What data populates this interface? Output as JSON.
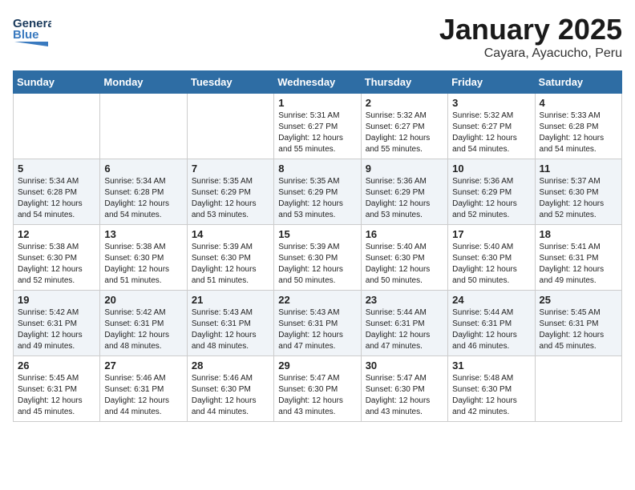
{
  "logo": {
    "line1": "General",
    "line2": "Blue"
  },
  "header": {
    "month": "January 2025",
    "location": "Cayara, Ayacucho, Peru"
  },
  "weekdays": [
    "Sunday",
    "Monday",
    "Tuesday",
    "Wednesday",
    "Thursday",
    "Friday",
    "Saturday"
  ],
  "weeks": [
    [
      {
        "day": "",
        "info": ""
      },
      {
        "day": "",
        "info": ""
      },
      {
        "day": "",
        "info": ""
      },
      {
        "day": "1",
        "info": "Sunrise: 5:31 AM\nSunset: 6:27 PM\nDaylight: 12 hours\nand 55 minutes."
      },
      {
        "day": "2",
        "info": "Sunrise: 5:32 AM\nSunset: 6:27 PM\nDaylight: 12 hours\nand 55 minutes."
      },
      {
        "day": "3",
        "info": "Sunrise: 5:32 AM\nSunset: 6:27 PM\nDaylight: 12 hours\nand 54 minutes."
      },
      {
        "day": "4",
        "info": "Sunrise: 5:33 AM\nSunset: 6:28 PM\nDaylight: 12 hours\nand 54 minutes."
      }
    ],
    [
      {
        "day": "5",
        "info": "Sunrise: 5:34 AM\nSunset: 6:28 PM\nDaylight: 12 hours\nand 54 minutes."
      },
      {
        "day": "6",
        "info": "Sunrise: 5:34 AM\nSunset: 6:28 PM\nDaylight: 12 hours\nand 54 minutes."
      },
      {
        "day": "7",
        "info": "Sunrise: 5:35 AM\nSunset: 6:29 PM\nDaylight: 12 hours\nand 53 minutes."
      },
      {
        "day": "8",
        "info": "Sunrise: 5:35 AM\nSunset: 6:29 PM\nDaylight: 12 hours\nand 53 minutes."
      },
      {
        "day": "9",
        "info": "Sunrise: 5:36 AM\nSunset: 6:29 PM\nDaylight: 12 hours\nand 53 minutes."
      },
      {
        "day": "10",
        "info": "Sunrise: 5:36 AM\nSunset: 6:29 PM\nDaylight: 12 hours\nand 52 minutes."
      },
      {
        "day": "11",
        "info": "Sunrise: 5:37 AM\nSunset: 6:30 PM\nDaylight: 12 hours\nand 52 minutes."
      }
    ],
    [
      {
        "day": "12",
        "info": "Sunrise: 5:38 AM\nSunset: 6:30 PM\nDaylight: 12 hours\nand 52 minutes."
      },
      {
        "day": "13",
        "info": "Sunrise: 5:38 AM\nSunset: 6:30 PM\nDaylight: 12 hours\nand 51 minutes."
      },
      {
        "day": "14",
        "info": "Sunrise: 5:39 AM\nSunset: 6:30 PM\nDaylight: 12 hours\nand 51 minutes."
      },
      {
        "day": "15",
        "info": "Sunrise: 5:39 AM\nSunset: 6:30 PM\nDaylight: 12 hours\nand 50 minutes."
      },
      {
        "day": "16",
        "info": "Sunrise: 5:40 AM\nSunset: 6:30 PM\nDaylight: 12 hours\nand 50 minutes."
      },
      {
        "day": "17",
        "info": "Sunrise: 5:40 AM\nSunset: 6:30 PM\nDaylight: 12 hours\nand 50 minutes."
      },
      {
        "day": "18",
        "info": "Sunrise: 5:41 AM\nSunset: 6:31 PM\nDaylight: 12 hours\nand 49 minutes."
      }
    ],
    [
      {
        "day": "19",
        "info": "Sunrise: 5:42 AM\nSunset: 6:31 PM\nDaylight: 12 hours\nand 49 minutes."
      },
      {
        "day": "20",
        "info": "Sunrise: 5:42 AM\nSunset: 6:31 PM\nDaylight: 12 hours\nand 48 minutes."
      },
      {
        "day": "21",
        "info": "Sunrise: 5:43 AM\nSunset: 6:31 PM\nDaylight: 12 hours\nand 48 minutes."
      },
      {
        "day": "22",
        "info": "Sunrise: 5:43 AM\nSunset: 6:31 PM\nDaylight: 12 hours\nand 47 minutes."
      },
      {
        "day": "23",
        "info": "Sunrise: 5:44 AM\nSunset: 6:31 PM\nDaylight: 12 hours\nand 47 minutes."
      },
      {
        "day": "24",
        "info": "Sunrise: 5:44 AM\nSunset: 6:31 PM\nDaylight: 12 hours\nand 46 minutes."
      },
      {
        "day": "25",
        "info": "Sunrise: 5:45 AM\nSunset: 6:31 PM\nDaylight: 12 hours\nand 45 minutes."
      }
    ],
    [
      {
        "day": "26",
        "info": "Sunrise: 5:45 AM\nSunset: 6:31 PM\nDaylight: 12 hours\nand 45 minutes."
      },
      {
        "day": "27",
        "info": "Sunrise: 5:46 AM\nSunset: 6:31 PM\nDaylight: 12 hours\nand 44 minutes."
      },
      {
        "day": "28",
        "info": "Sunrise: 5:46 AM\nSunset: 6:30 PM\nDaylight: 12 hours\nand 44 minutes."
      },
      {
        "day": "29",
        "info": "Sunrise: 5:47 AM\nSunset: 6:30 PM\nDaylight: 12 hours\nand 43 minutes."
      },
      {
        "day": "30",
        "info": "Sunrise: 5:47 AM\nSunset: 6:30 PM\nDaylight: 12 hours\nand 43 minutes."
      },
      {
        "day": "31",
        "info": "Sunrise: 5:48 AM\nSunset: 6:30 PM\nDaylight: 12 hours\nand 42 minutes."
      },
      {
        "day": "",
        "info": ""
      }
    ]
  ]
}
